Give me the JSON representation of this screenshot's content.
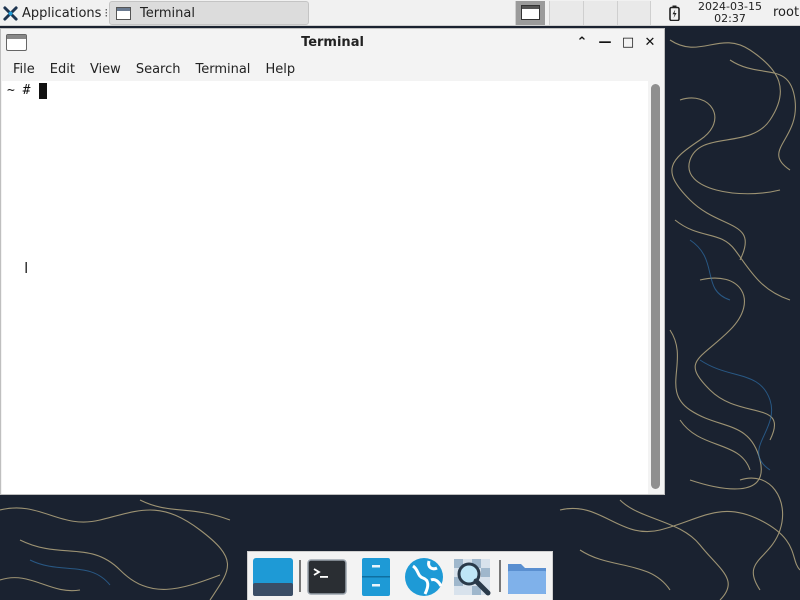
{
  "top_panel": {
    "applications_label": "Applications",
    "applications_separator": "⁝",
    "taskbar_window_title": "Terminal",
    "clock_date": "2024-03-15",
    "clock_time": "02:37",
    "user": "root"
  },
  "window": {
    "title": "Terminal",
    "buttons": {
      "shade": "⌃",
      "minimize": "—",
      "maximize": "□",
      "close": "✕"
    },
    "menu": [
      "File",
      "Edit",
      "View",
      "Search",
      "Terminal",
      "Help"
    ]
  },
  "terminal": {
    "prompt": "~ # "
  },
  "dock": {
    "items": [
      "show-desktop-icon",
      "terminal-icon",
      "file-cabinet-icon",
      "web-browser-icon",
      "search-icon",
      "folder-icon"
    ]
  },
  "colors": {
    "wallpaper": "#1a2230",
    "panel": "#f1f1f1",
    "accent_blue": "#1e9ad6"
  }
}
